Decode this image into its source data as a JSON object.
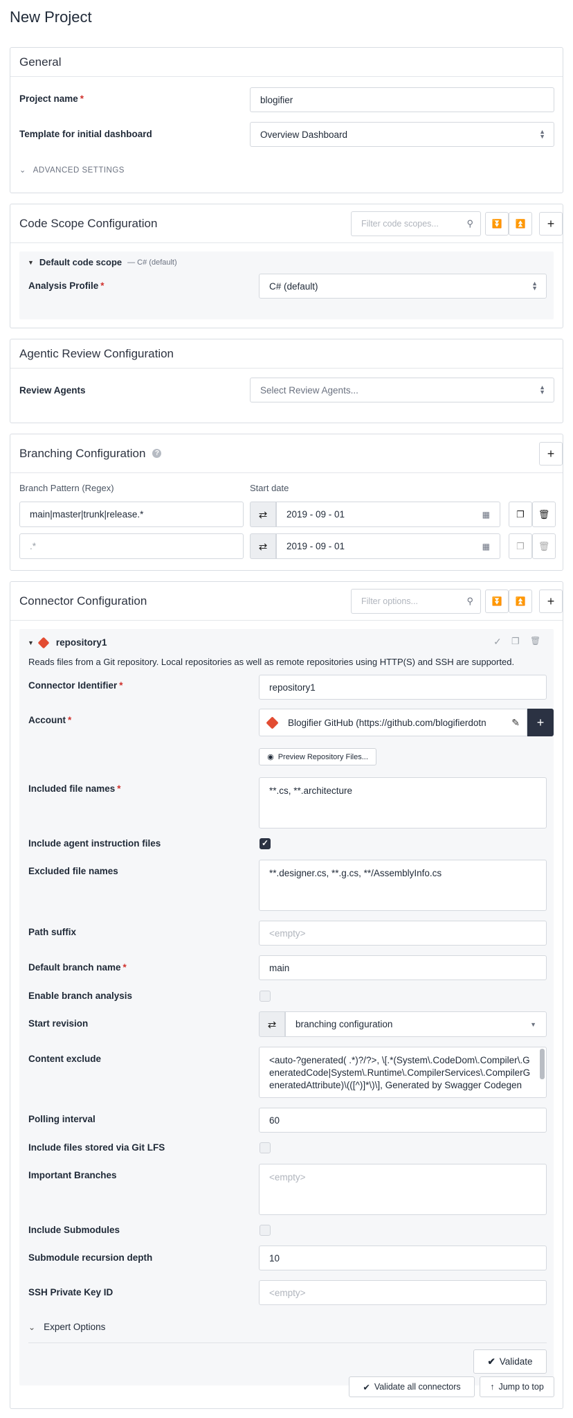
{
  "page": {
    "title": "New Project"
  },
  "general": {
    "title": "General",
    "project_name_label": "Project name",
    "project_name_value": "blogifier",
    "template_label": "Template for initial dashboard",
    "template_value": "Overview Dashboard",
    "advanced_label": "ADVANCED SETTINGS"
  },
  "code_scope": {
    "title": "Code Scope Configuration",
    "filter_placeholder": "Filter code scopes...",
    "scope_name": "Default code scope",
    "scope_hint": "— C# (default)",
    "analysis_label": "Analysis Profile",
    "analysis_value": "C# (default)"
  },
  "agentic": {
    "title": "Agentic Review Configuration",
    "agents_label": "Review Agents",
    "agents_placeholder": "Select Review Agents..."
  },
  "branching": {
    "title": "Branching Configuration",
    "col_pattern": "Branch Pattern (Regex)",
    "col_start": "Start date",
    "rows": [
      {
        "pattern": "main|master|trunk|release.*",
        "date": "2019 - 09 - 01"
      },
      {
        "pattern": ".*",
        "date": "2019 - 09 - 01"
      }
    ]
  },
  "connector": {
    "title": "Connector Configuration",
    "filter_placeholder": "Filter options...",
    "name": "repository1",
    "description": "Reads files from a Git repository. Local repositories as well as remote repositories using HTTP(S) and SSH are supported.",
    "fields": {
      "identifier_label": "Connector Identifier",
      "identifier_value": "repository1",
      "account_label": "Account",
      "account_value": "Blogifier GitHub (https://github.com/blogifierdotn",
      "preview_label": "Preview Repository Files...",
      "included_label": "Included file names",
      "included_value": "**.cs, **.architecture",
      "agent_files_label": "Include agent instruction files",
      "excluded_label": "Excluded file names",
      "excluded_value": "**.designer.cs, **.g.cs, **/AssemblyInfo.cs",
      "path_suffix_label": "Path suffix",
      "path_suffix_placeholder": "<empty>",
      "default_branch_label": "Default branch name",
      "default_branch_value": "main",
      "branch_analysis_label": "Enable branch analysis",
      "start_revision_label": "Start revision",
      "start_revision_value": "branching configuration",
      "content_exclude_label": "Content exclude",
      "content_exclude_value": "<auto-?generated( .*)?/?>, \\[.*(System\\.CodeDom\\.Compiler\\.GeneratedCode|System\\.Runtime\\.CompilerServices\\.CompilerGeneratedAttribute)\\(([^)]*\\)\\], Generated by Swagger Codegen",
      "polling_label": "Polling interval",
      "polling_value": "60",
      "lfs_label": "Include files stored via Git LFS",
      "important_label": "Important Branches",
      "important_placeholder": "<empty>",
      "submodules_label": "Include Submodules",
      "recursion_label": "Submodule recursion depth",
      "recursion_value": "10",
      "ssh_label": "SSH Private Key ID",
      "ssh_placeholder": "<empty>"
    },
    "expert_label": "Expert Options",
    "validate_label": "Validate",
    "validate_all_label": "Validate all connectors",
    "jump_top_label": "Jump to top"
  },
  "colors": {
    "required": "#d0312d",
    "dark_button": "#2b3243",
    "git_icon": "#e24c32"
  }
}
